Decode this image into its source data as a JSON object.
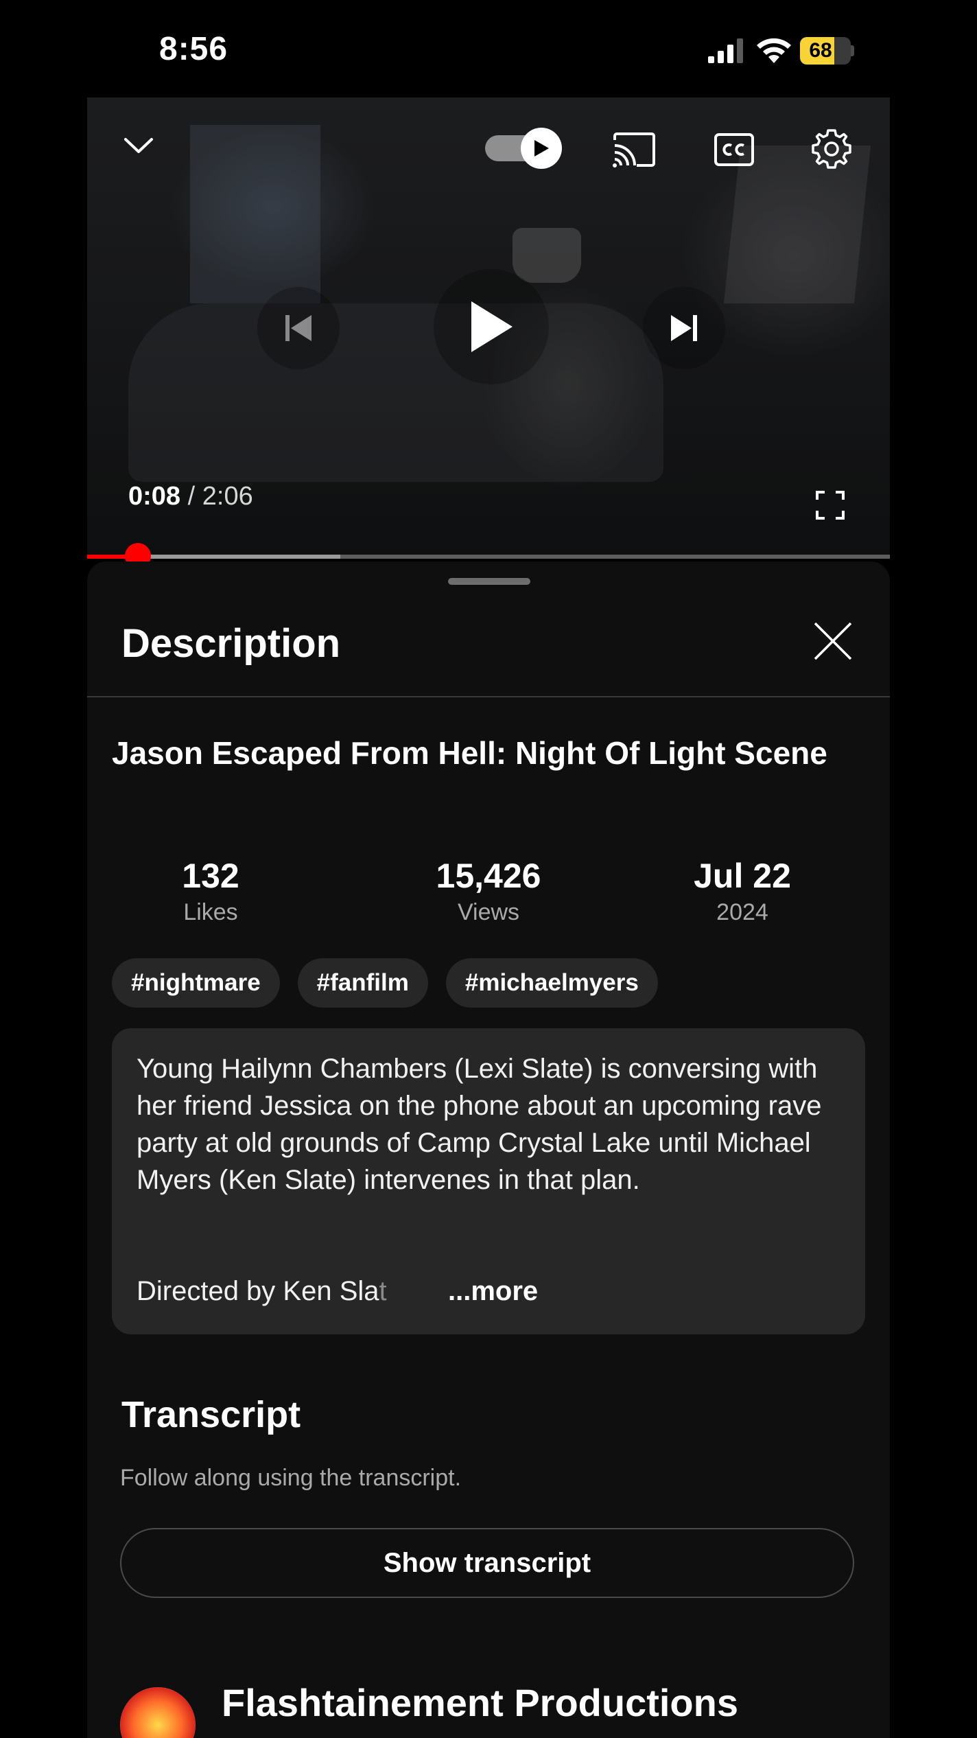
{
  "status_bar": {
    "time": "8:56",
    "battery_percent": "68",
    "battery_level": 0.68
  },
  "player": {
    "current_time": "0:08",
    "separator": "/",
    "duration": "2:06",
    "played_fraction": 0.063,
    "buffered_fraction": 0.315,
    "autoplay_on": true,
    "icons": [
      "chevron-down-icon",
      "autoplay-toggle-icon",
      "cast-icon",
      "cc-icon",
      "gear-icon",
      "previous-icon",
      "play-icon",
      "next-icon",
      "fullscreen-icon"
    ],
    "accent_color": "#ff0000"
  },
  "description_panel": {
    "title": "Description",
    "video_title": "Jason Escaped From Hell: Night  Of Light Scene",
    "stats": [
      {
        "value": "132",
        "label": "Likes"
      },
      {
        "value": "15,426",
        "label": "Views"
      },
      {
        "value": "Jul 22",
        "label": "2024"
      }
    ],
    "tags": [
      "#nightmare",
      "#fanfilm",
      "#michaelmyers"
    ],
    "description_text": "Young Hailynn Chambers (Lexi Slate) is conversing with her friend Jessica on the phone about an upcoming rave party at old grounds of Camp Crystal Lake until Michael Myers (Ken Slate) intervenes in that plan.",
    "description_truncated_visible": "Directed by Ken Sla",
    "description_truncated_fade": "t",
    "more_label": "...more"
  },
  "transcript": {
    "title": "Transcript",
    "subtitle": "Follow along using the transcript.",
    "button_label": "Show transcript"
  },
  "channel": {
    "name": "Flashtainement Productions"
  }
}
